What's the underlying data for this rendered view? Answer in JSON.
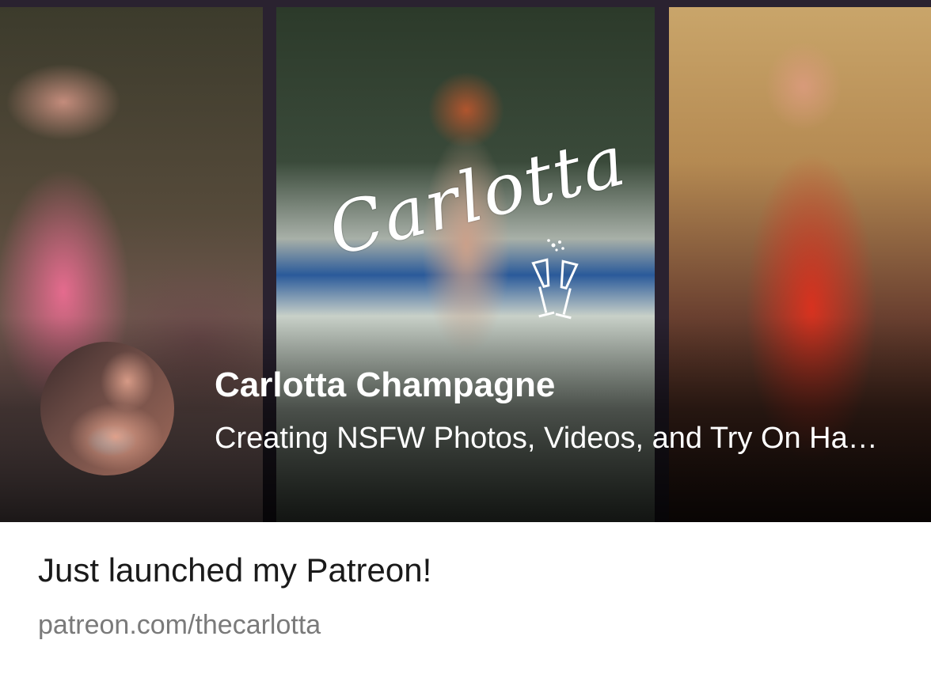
{
  "banner": {
    "logo_text": "Carlotta",
    "creator_name": "Carlotta Champagne",
    "tagline": "Creating NSFW Photos, Videos, and Try On Hauls"
  },
  "post": {
    "title": "Just launched my Patreon!",
    "link": "patreon.com/thecarlotta"
  },
  "colors": {
    "background": "#ffffff",
    "title_text": "#1a1a1a",
    "link_text": "#7a7a7a",
    "banner_frame": "#2a2230"
  },
  "icons": [
    "champagne-glasses-icon"
  ]
}
